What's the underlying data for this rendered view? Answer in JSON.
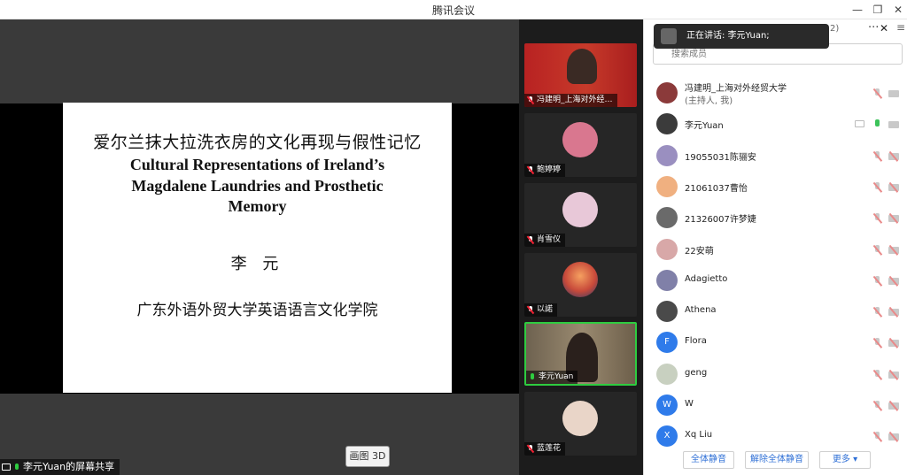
{
  "window": {
    "title": "腾讯会议",
    "minimize": "—",
    "restore": "❐",
    "close": "✕"
  },
  "slide": {
    "cn_title": "爱尔兰抹大拉洗衣房的文化再现与假性记忆",
    "en_line1": "Cultural Representations of Ireland’s",
    "en_line2": "Magdalene Laundries and Prosthetic",
    "en_line3": "Memory",
    "author": "李 元",
    "school": "广东外语外贸大学英语语言文化学院"
  },
  "share": {
    "draw_button": "画图 3D",
    "status": "李元Yuan的屏幕共享"
  },
  "tiles": [
    {
      "name": "冯建明_上海对外经…",
      "color": "#c0392b",
      "mic": "off"
    },
    {
      "name": "鲍婷婷",
      "color": "#d9778f",
      "mic": "off"
    },
    {
      "name": "肖雪仪",
      "color": "#e8c8d8",
      "mic": "off"
    },
    {
      "name": "以諾",
      "color": "#e0603a",
      "mic": "off"
    },
    {
      "name": "李元Yuan",
      "color": "#8a7a62",
      "mic": "on"
    },
    {
      "name": "蓝莲花",
      "color": "#e9d5c8",
      "mic": "off"
    }
  ],
  "panel": {
    "speaking": "正在讲话: 李元Yuan;",
    "header_partial": "2)",
    "more": "···",
    "close": "✕",
    "menu": "≡",
    "search_placeholder": "搜索成员",
    "members": [
      {
        "name": "冯建明_上海对外经贸大学",
        "sub": "(主持人, 我)",
        "avatar": "",
        "color": "#8b3a3a"
      },
      {
        "name": "李元Yuan",
        "sub": "",
        "avatar": "",
        "color": "#3b3b3b"
      },
      {
        "name": "19055031陈骊安",
        "sub": "",
        "avatar": "",
        "color": "#9a8fc0"
      },
      {
        "name": "21061037曹怡",
        "sub": "",
        "avatar": "",
        "color": "#f0b080"
      },
      {
        "name": "21326007许梦婕",
        "sub": "",
        "avatar": "",
        "color": "#6a6a6a"
      },
      {
        "name": "22安萌",
        "sub": "",
        "avatar": "",
        "color": "#d8a8a8"
      },
      {
        "name": "Adagietto",
        "sub": "",
        "avatar": "",
        "color": "#8080a8"
      },
      {
        "name": "Athena",
        "sub": "",
        "avatar": "",
        "color": "#4a4a4a"
      },
      {
        "name": "Flora",
        "sub": "",
        "avatar": "F",
        "color": "#2f7bea"
      },
      {
        "name": "geng",
        "sub": "",
        "avatar": "",
        "color": "#c8d0c0"
      },
      {
        "name": "W",
        "sub": "",
        "avatar": "W",
        "color": "#2f7bea"
      },
      {
        "name": "Xq Liu",
        "sub": "",
        "avatar": "X",
        "color": "#2f7bea"
      }
    ],
    "footer": {
      "mute_all": "全体静音",
      "unmute_all": "解除全体静音",
      "more": "更多 ▾"
    }
  }
}
